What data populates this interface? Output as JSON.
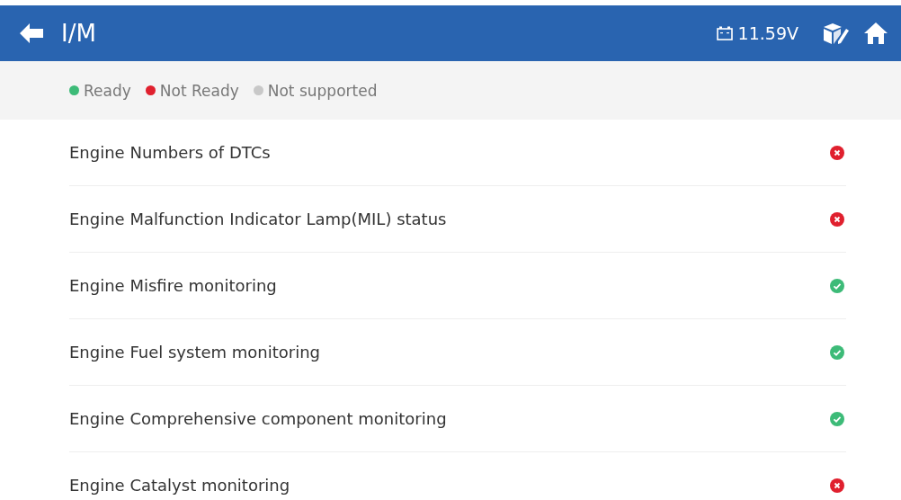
{
  "header": {
    "title": "I/M",
    "voltage": "11.59V"
  },
  "legend": [
    {
      "kind": "ready",
      "label": "Ready"
    },
    {
      "kind": "not_ready",
      "label": "Not Ready"
    },
    {
      "kind": "unsupported",
      "label": "Not supported"
    }
  ],
  "rows": [
    {
      "label": "Engine Numbers of DTCs",
      "kind": "not_ready"
    },
    {
      "label": "Engine Malfunction Indicator Lamp(MIL) status",
      "kind": "not_ready"
    },
    {
      "label": "Engine Misfire monitoring",
      "kind": "ready"
    },
    {
      "label": "Engine Fuel system monitoring",
      "kind": "ready"
    },
    {
      "label": "Engine Comprehensive component monitoring",
      "kind": "ready"
    },
    {
      "label": "Engine Catalyst monitoring",
      "kind": "not_ready"
    }
  ]
}
